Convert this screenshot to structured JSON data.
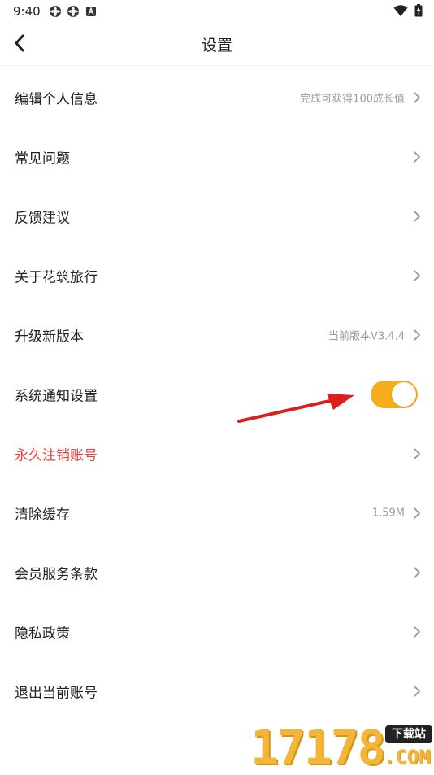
{
  "status_bar": {
    "time": "9:40",
    "left_icons": [
      "app-notification-icon",
      "app-notification-icon",
      "text-notification-icon"
    ],
    "right_icons": [
      "wifi-icon",
      "battery-charging-icon"
    ]
  },
  "header": {
    "title": "设置",
    "back_icon": "chevron-left-icon"
  },
  "settings": [
    {
      "label": "编辑个人信息",
      "value": "完成可获得100成长值",
      "type": "link"
    },
    {
      "label": "常见问题",
      "value": "",
      "type": "link"
    },
    {
      "label": "反馈建议",
      "value": "",
      "type": "link"
    },
    {
      "label": "关于花筑旅行",
      "value": "",
      "type": "link"
    },
    {
      "label": "升级新版本",
      "value": "当前版本V3.4.4",
      "type": "link"
    },
    {
      "label": "系统通知设置",
      "value": "",
      "type": "toggle",
      "enabled": true
    },
    {
      "label": "永久注销账号",
      "value": "",
      "type": "link",
      "danger": true
    },
    {
      "label": "清除缓存",
      "value": "1.59M",
      "type": "link"
    },
    {
      "label": "会员服务条款",
      "value": "",
      "type": "link"
    },
    {
      "label": "隐私政策",
      "value": "",
      "type": "link"
    },
    {
      "label": "退出当前账号",
      "value": "",
      "type": "link"
    }
  ],
  "colors": {
    "toggle_on": "#f6ad1b",
    "danger_text": "#ee4040",
    "secondary_text": "#9a9a9a",
    "annotation_arrow": "#d91f1f"
  },
  "watermark": {
    "digits": "17178",
    "badge": "下载站",
    "domain": ".COM"
  }
}
